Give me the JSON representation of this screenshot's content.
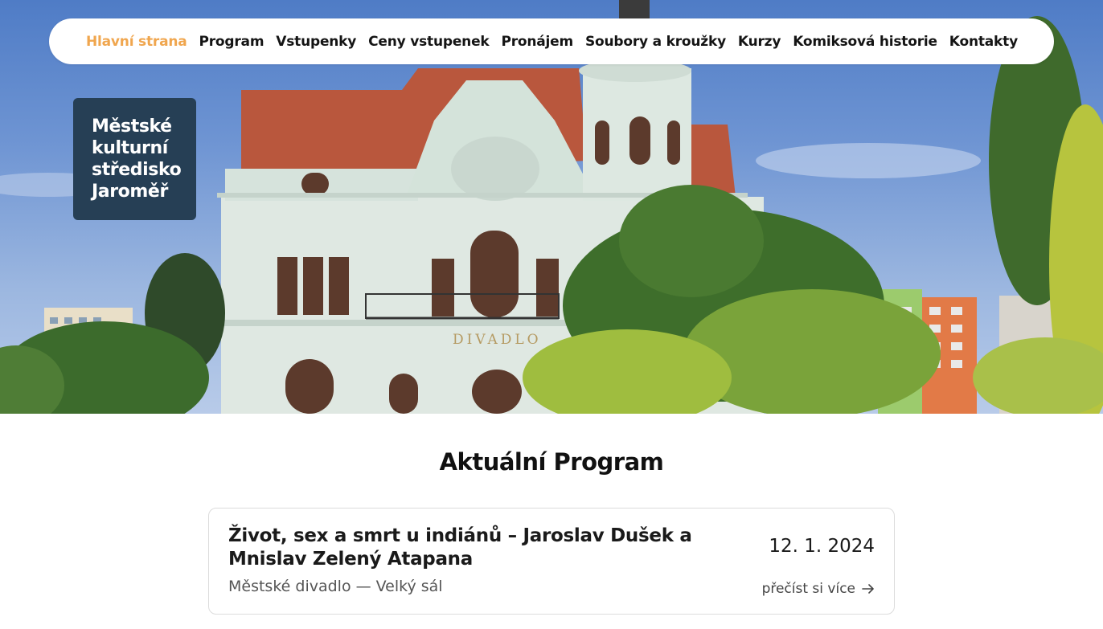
{
  "nav": {
    "items": [
      {
        "label": "Hlavní strana",
        "active": true
      },
      {
        "label": "Program"
      },
      {
        "label": "Vstupenky"
      },
      {
        "label": "Ceny vstupenek"
      },
      {
        "label": "Pronájem"
      },
      {
        "label": "Soubory a kroužky"
      },
      {
        "label": "Kurzy"
      },
      {
        "label": "Komiksová historie"
      },
      {
        "label": "Kontakty"
      }
    ]
  },
  "brand": {
    "line1": "Městské",
    "line2": "kulturní",
    "line3": "středisko",
    "line4": "Jaroměř"
  },
  "hero": {
    "building_sign": "DIVADLO"
  },
  "section": {
    "title": "Aktuální Program"
  },
  "event": {
    "title": "Život, sex a smrt u indiánů – Jaroslav Dušek a Mnislav Zelený Atapana",
    "venue": "Městské divadlo — Velký sál",
    "date": "12. 1. 2024",
    "more_label": "přečíst si více",
    "more_icon": "arrow-right-icon"
  },
  "colors": {
    "accent": "#f0a64e",
    "brand_bg": "#263f55",
    "sky": "#6f95d3"
  }
}
